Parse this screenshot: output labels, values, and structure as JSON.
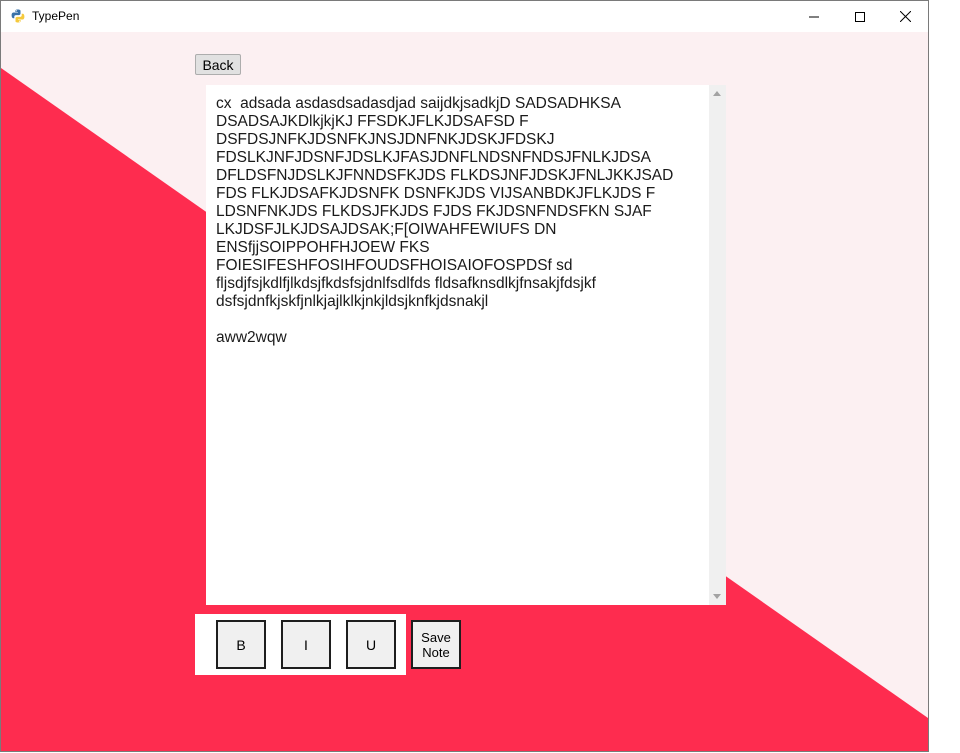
{
  "window": {
    "title": "TypePen",
    "app_icon": "python-icon",
    "controls": {
      "minimize_icon": "minimize-icon",
      "maximize_icon": "maximize-icon",
      "close_icon": "close-icon"
    }
  },
  "colors": {
    "background_pink": "#fcf0f2",
    "background_red": "#fe2c4f",
    "editor_bg": "#ffffff",
    "button_border": "#1e1e1e",
    "button_bg": "#f0f0f0"
  },
  "toolbar": {
    "back_label": "Back"
  },
  "editor": {
    "content": "cx  adsada asdasdsadasdjad saijdkjsadkjD SADSADHKSA DSADSAJKDlkjkjKJ FFSDKJFLKJDSAFSD F DSFDSJNFKJDSNFKJNSJDNFNKJDSKJFDSKJ FDSLKJNFJDSNFJDSLKJFASJDNFLNDSNFNDSJFNLKJDSA DFLDSFNJDSLKJFNNDSFKJDS FLKDSJNFJDSKJFNLJKKJSAD FDS FLKJDSAFKJDSNFK DSNFKJDS VIJSANBDKJFLKJDS F LDSNFNKJDS FLKDSJFKJDS FJDS FKJDSNFNDSFKN SJAF LKJDSFJLKJDSAJDSAK;F[OIWAHFEWIUFS DN ENSfjjSOIPPOHFHJOEW FKS FOIESIFESHFOSIHFOUDSFHOISAIOFOSPDSf sd fljsdjfsjkdlfjlkdsjfkdsfsjdnlfsdlfds fldsafknsdlkjfnsakjfdsjkf dsfsjdnfkjskfjnlkjajlklkjnkjldsjknfkjdsnakjl\n\naww2wqw"
  },
  "format_buttons": {
    "bold": "B",
    "italic": "I",
    "underline": "U"
  },
  "save_button": {
    "label": "Save Note"
  }
}
